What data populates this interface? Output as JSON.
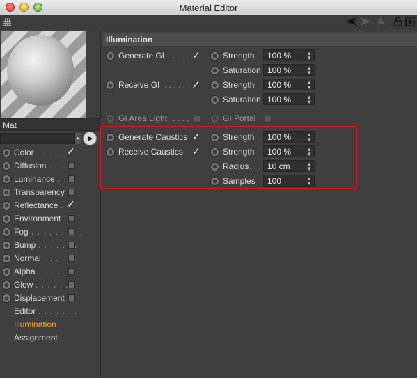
{
  "window": {
    "title": "Material Editor"
  },
  "material": {
    "name": "Mat"
  },
  "channels": [
    {
      "label": "Color",
      "dots": ". . . . . . .",
      "state": "checked"
    },
    {
      "label": "Diffusion",
      "dots": ". . . .",
      "state": "unchecked"
    },
    {
      "label": "Luminance",
      "dots": ". . .",
      "state": "unchecked"
    },
    {
      "label": "Transparency",
      "dots": "",
      "state": "unchecked"
    },
    {
      "label": "Reflectance",
      "dots": ". .",
      "state": "checked"
    },
    {
      "label": "Environment",
      "dots": "",
      "state": "unchecked"
    },
    {
      "label": "Fog",
      "dots": ". . . . . . . . .",
      "state": "unchecked"
    },
    {
      "label": "Bump",
      "dots": ". . . . . . .",
      "state": "unchecked"
    },
    {
      "label": "Normal",
      "dots": ". . . . . .",
      "state": "unchecked"
    },
    {
      "label": "Alpha",
      "dots": ". . . . . . .",
      "state": "unchecked"
    },
    {
      "label": "Glow",
      "dots": ". . . . . . .",
      "state": "unchecked"
    },
    {
      "label": "Displacement",
      "dots": "",
      "state": "unchecked"
    },
    {
      "label": "Editor",
      "dots": ". . . . . . .",
      "state": "none"
    },
    {
      "label": "Illumination",
      "dots": "",
      "state": "none",
      "active": true
    },
    {
      "label": "Assignment",
      "dots": "",
      "state": "none"
    }
  ],
  "illumination": {
    "title": "Illumination",
    "generate_gi": {
      "label": "Generate GI",
      "dots": ". . . . . .",
      "checked": true,
      "strength_label": "Strength",
      "strength": "100 %",
      "saturation_label": "Saturation",
      "saturation": "100 %"
    },
    "receive_gi": {
      "label": "Receive GI",
      "dots": ". . . . . . .",
      "checked": true,
      "strength_label": "Strength",
      "strength": "100 %",
      "saturation_label": "Saturation",
      "saturation": "100 %"
    },
    "gi_area_light": {
      "label": "GI Area Light",
      "dots": ". . . .",
      "checked": false
    },
    "gi_portal": {
      "label": "GI Portal",
      "checked": false
    },
    "generate_caustics": {
      "label": "Generate Caustics",
      "checked": true,
      "strength_label": "Strength",
      "strength": "100 %"
    },
    "receive_caustics": {
      "label": "Receive Caustics",
      "checked": true,
      "strength_label": "Strength",
      "strength": "100 %",
      "radius_label": "Radius",
      "radius_dots": ". . .",
      "radius": "10 cm",
      "samples_label": "Samples",
      "samples": "100"
    }
  },
  "colors": {
    "active_tab": "#f0a030",
    "highlight_box": "#d4191f"
  },
  "icons": [
    "grip-icon",
    "back-arrow-icon",
    "forward-arrow-icon",
    "up-arrow-icon",
    "lock-icon",
    "new-window-icon",
    "eyedropper-icon"
  ]
}
